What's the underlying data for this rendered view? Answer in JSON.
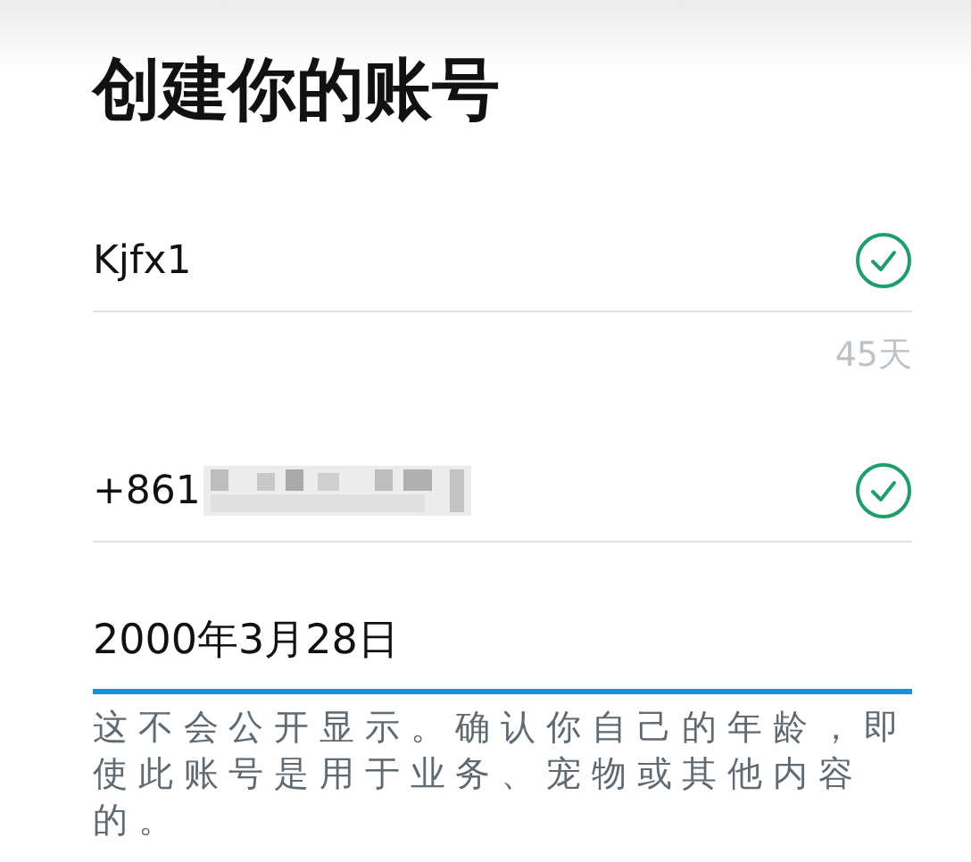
{
  "title": "创建你的账号",
  "fields": [
    {
      "kind": "text",
      "value": "Kjfx1",
      "valid": true,
      "focused": false,
      "counter": "45天"
    },
    {
      "kind": "phone",
      "value": "+861",
      "redacted": true,
      "valid": true,
      "focused": false
    },
    {
      "kind": "date",
      "value": "2000年3月28日",
      "valid": false,
      "focused": true,
      "hint": "这不会公开显示。确认你自己的年龄，即使此账号是用于业务、宠物或其他内容的。"
    }
  ]
}
